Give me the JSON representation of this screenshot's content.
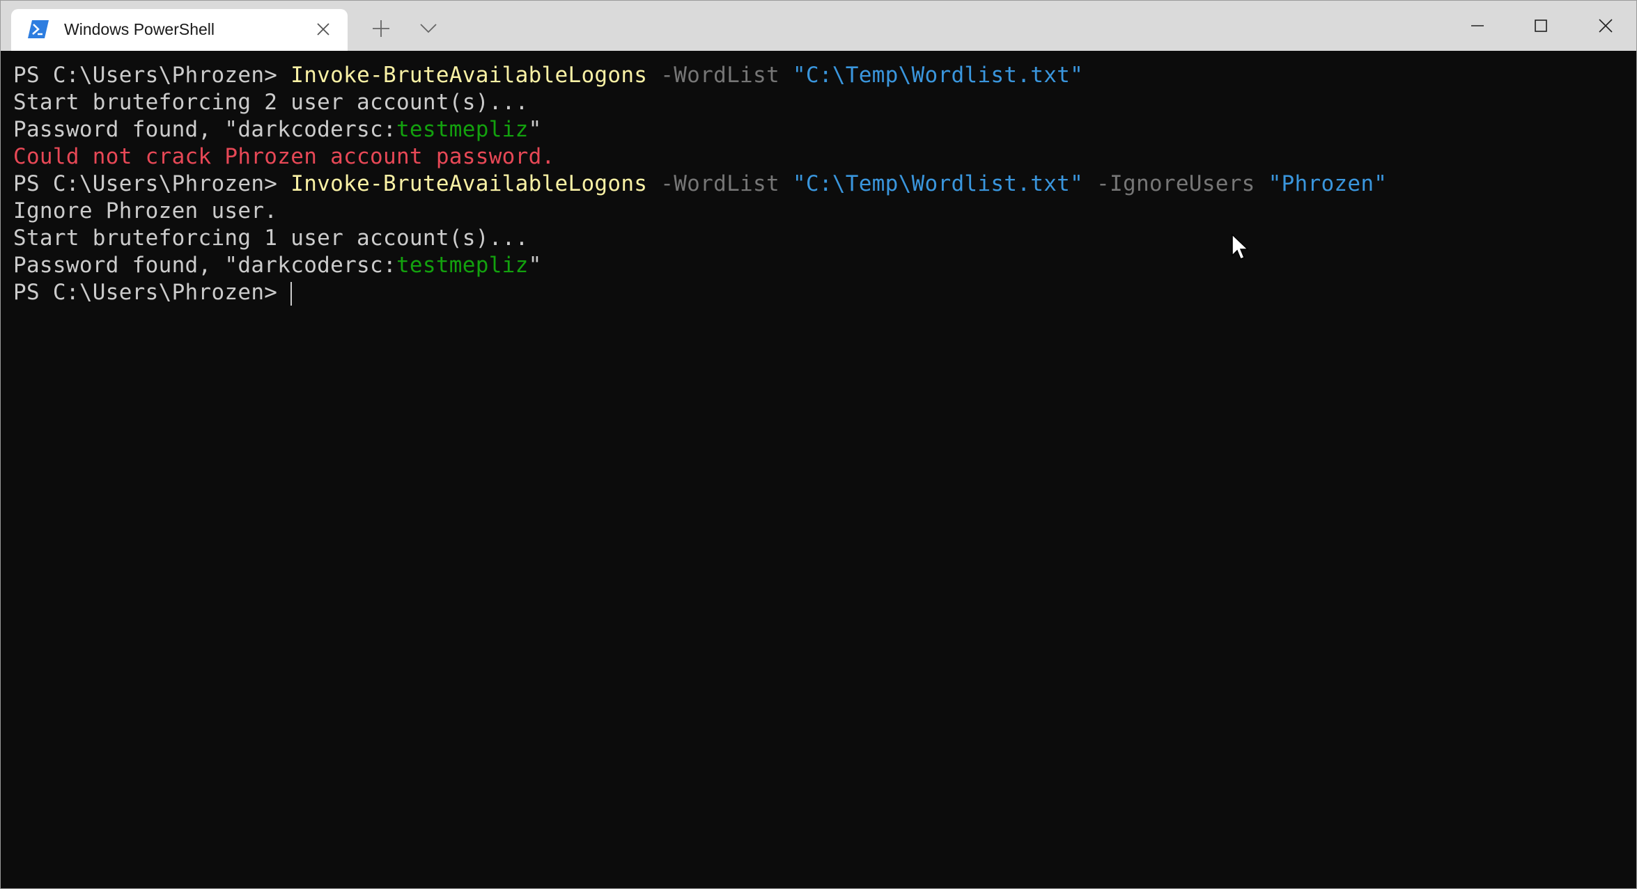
{
  "tab": {
    "title": "Windows PowerShell",
    "icon": "powershell-icon"
  },
  "colors": {
    "default": "#cccccc",
    "command": "#f9f1a5",
    "parameter": "#767676",
    "string": "#3a96dd",
    "success": "#13a10e",
    "error": "#e74856",
    "background": "#0c0c0c"
  },
  "terminal": {
    "lines": [
      [
        {
          "t": "PS C:\\Users\\Phrozen> ",
          "c": "default"
        },
        {
          "t": "Invoke-BruteAvailableLogons",
          "c": "command"
        },
        {
          "t": " -WordList",
          "c": "parameter"
        },
        {
          "t": " \"C:\\Temp\\Wordlist.txt\"",
          "c": "string"
        }
      ],
      [
        {
          "t": "Start bruteforcing 2 user account(s)...",
          "c": "default"
        }
      ],
      [
        {
          "t": "Password found, \"darkcodersc:",
          "c": "default"
        },
        {
          "t": "testmepliz",
          "c": "success"
        },
        {
          "t": "\"",
          "c": "default"
        }
      ],
      [
        {
          "t": "Could not crack Phrozen account password.",
          "c": "error"
        }
      ],
      [
        {
          "t": "PS C:\\Users\\Phrozen> ",
          "c": "default"
        },
        {
          "t": "Invoke-BruteAvailableLogons",
          "c": "command"
        },
        {
          "t": " -WordList",
          "c": "parameter"
        },
        {
          "t": " \"C:\\Temp\\Wordlist.txt\"",
          "c": "string"
        },
        {
          "t": " -IgnoreUsers",
          "c": "parameter"
        },
        {
          "t": " \"Phrozen\"",
          "c": "string"
        }
      ],
      [
        {
          "t": "Ignore Phrozen user.",
          "c": "default"
        }
      ],
      [
        {
          "t": "Start bruteforcing 1 user account(s)...",
          "c": "default"
        }
      ],
      [
        {
          "t": "Password found, \"darkcodersc:",
          "c": "default"
        },
        {
          "t": "testmepliz",
          "c": "success"
        },
        {
          "t": "\"",
          "c": "default"
        }
      ]
    ],
    "prompt": "PS C:\\Users\\Phrozen> "
  }
}
